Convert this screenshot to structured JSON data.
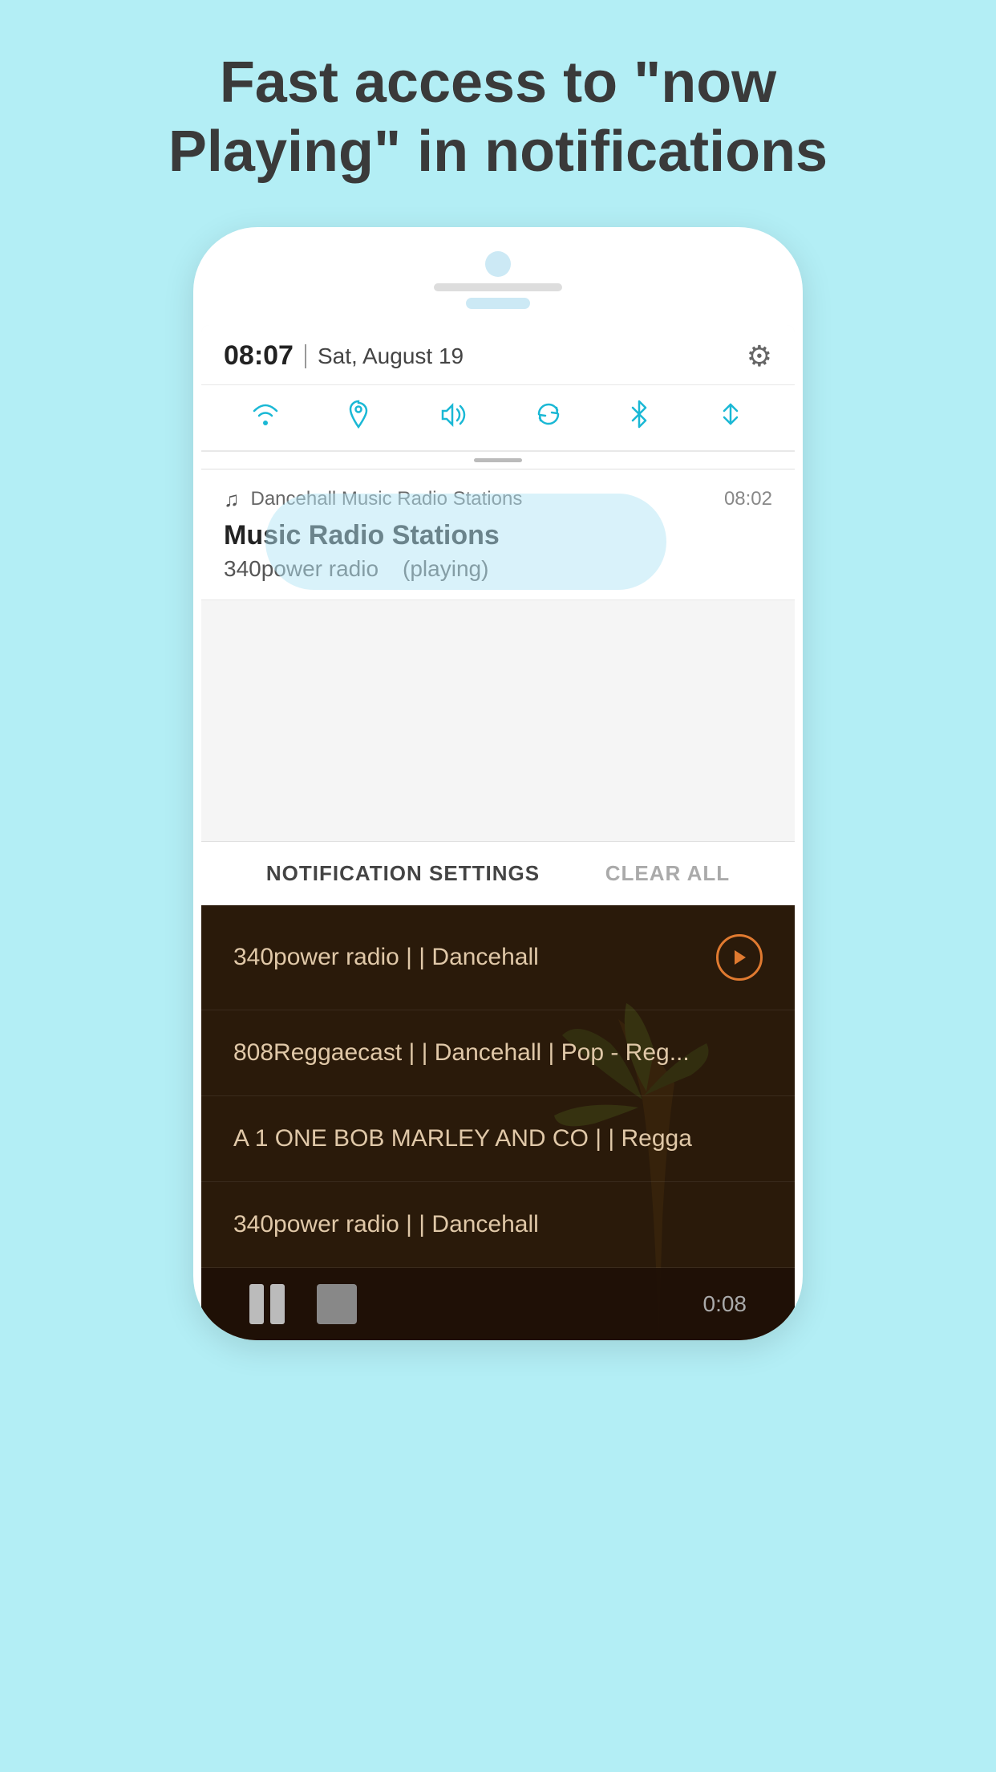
{
  "headline": {
    "line1": "Fast access to \"now",
    "line2": "Playing\" in notifications"
  },
  "status_bar": {
    "time": "08:07",
    "divider": "|",
    "date": "Sat, August 19"
  },
  "quick_settings": {
    "icons": [
      "wifi",
      "location",
      "volume",
      "sync",
      "bluetooth",
      "transfer"
    ]
  },
  "notification": {
    "music_icon": "♫",
    "app_name": "Dancehall Music Radio Stations",
    "time": "08:02",
    "title": "Music Radio Stations",
    "station": "340power radio",
    "status": "(playing)"
  },
  "notification_bar": {
    "settings_label": "NOTIFICATION SETTINGS",
    "clear_label": "CLEAR ALL"
  },
  "radio_list": {
    "items": [
      {
        "text": "340power radio | | Dancehall",
        "has_play": true
      },
      {
        "text": "808Reggaecast | | Dancehall | Pop - Reg...",
        "has_play": false
      },
      {
        "text": "A 1 ONE BOB MARLEY AND CO | | Regga",
        "has_play": false
      },
      {
        "text": "340power radio | | Dancehall",
        "has_play": false
      }
    ]
  },
  "player_bar": {
    "timer": "0:08"
  }
}
